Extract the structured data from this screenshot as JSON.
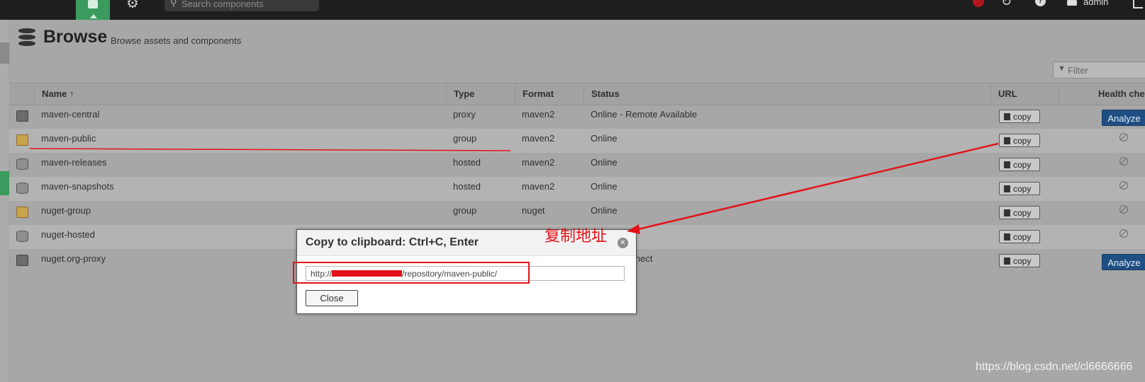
{
  "topbar": {
    "search_placeholder": "Search components",
    "user": "admin"
  },
  "page": {
    "title": "Browse",
    "subtitle": "Browse assets and components",
    "filter_placeholder": "Filter"
  },
  "grid": {
    "headers": {
      "name": "Name",
      "type": "Type",
      "format": "Format",
      "status": "Status",
      "url": "URL",
      "health": "Health check"
    },
    "sort_indicator": "↑",
    "rows": [
      {
        "icon": "proxy-repo-icon",
        "name": "maven-central",
        "type": "proxy",
        "format": "maven2",
        "status": "Online - Remote Available",
        "copy": "copy",
        "health": "Analyze"
      },
      {
        "icon": "group-repo-icon",
        "name": "maven-public",
        "type": "group",
        "format": "maven2",
        "status": "Online",
        "copy": "copy",
        "health": ""
      },
      {
        "icon": "hosted-repo-icon",
        "name": "maven-releases",
        "type": "hosted",
        "format": "maven2",
        "status": "Online",
        "copy": "copy",
        "health": ""
      },
      {
        "icon": "hosted-repo-icon",
        "name": "maven-snapshots",
        "type": "hosted",
        "format": "maven2",
        "status": "Online",
        "copy": "copy",
        "health": ""
      },
      {
        "icon": "group-repo-icon",
        "name": "nuget-group",
        "type": "group",
        "format": "nuget",
        "status": "Online",
        "copy": "copy",
        "health": ""
      },
      {
        "icon": "hosted-repo-icon",
        "name": "nuget-hosted",
        "type": "",
        "format": "",
        "status": "",
        "copy": "copy",
        "health": ""
      },
      {
        "icon": "proxy-repo-icon",
        "name": "nuget.org-proxy",
        "type": "",
        "format": "",
        "status": "ady to Connect",
        "copy": "copy",
        "health": "Analyze"
      }
    ]
  },
  "dialog": {
    "title": "Copy to clipboard: Ctrl+C, Enter",
    "url_prefix": "http://",
    "url_suffix": "/repository/maven-public/",
    "close_label": "Close"
  },
  "annotation": {
    "label": "复制地址",
    "color": "#e3121a"
  },
  "watermark": "https://blog.csdn.net/cl6666666"
}
